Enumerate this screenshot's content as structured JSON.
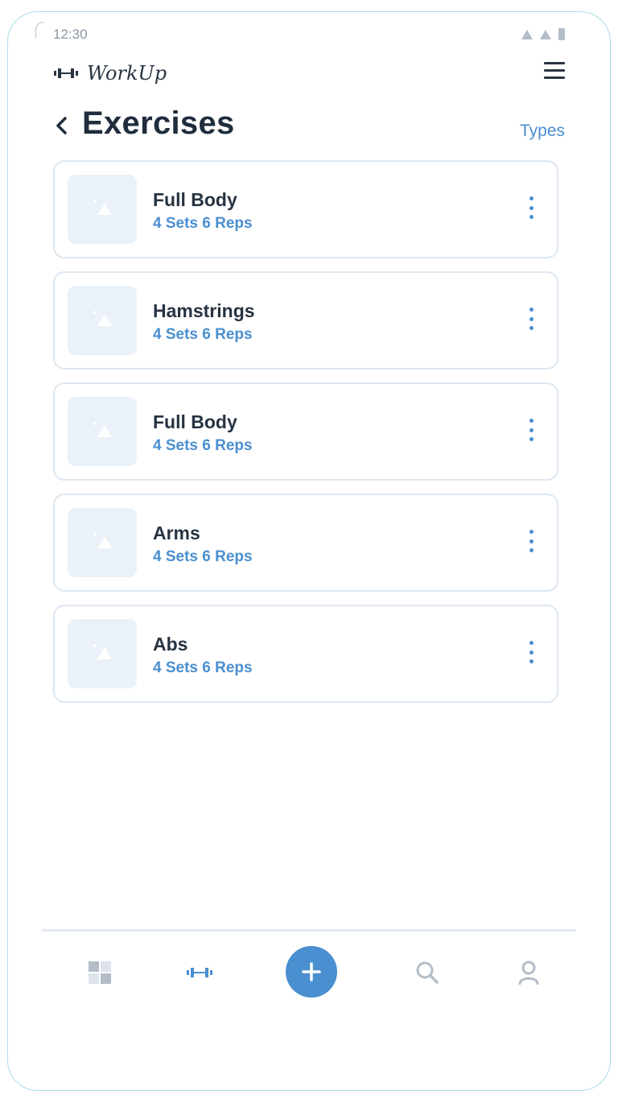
{
  "status_bar": {
    "time": "12:30"
  },
  "brand": {
    "name": "WorkUp"
  },
  "header": {
    "title": "Exercises",
    "types_link": "Types"
  },
  "exercises": [
    {
      "name": "Full Body",
      "detail": "4 Sets 6 Reps"
    },
    {
      "name": "Hamstrings",
      "detail": "4 Sets 6 Reps"
    },
    {
      "name": "Full Body",
      "detail": "4 Sets 6 Reps"
    },
    {
      "name": "Arms",
      "detail": "4 Sets 6 Reps"
    },
    {
      "name": "Abs",
      "detail": "4 Sets 6 Reps"
    }
  ],
  "bottom_nav": {
    "items": [
      {
        "icon": "dashboard-icon",
        "active": false
      },
      {
        "icon": "dumbbell-icon",
        "active": true
      },
      {
        "icon": "plus-icon",
        "active": false
      },
      {
        "icon": "search-icon",
        "active": false
      },
      {
        "icon": "profile-icon",
        "active": false
      }
    ]
  },
  "colors": {
    "accent": "#4a8fd0",
    "text_dark": "#1f2d3d",
    "card_border": "#dde7f1",
    "thumb_bg": "#eaf1f8",
    "muted": "#b3bdc8"
  }
}
